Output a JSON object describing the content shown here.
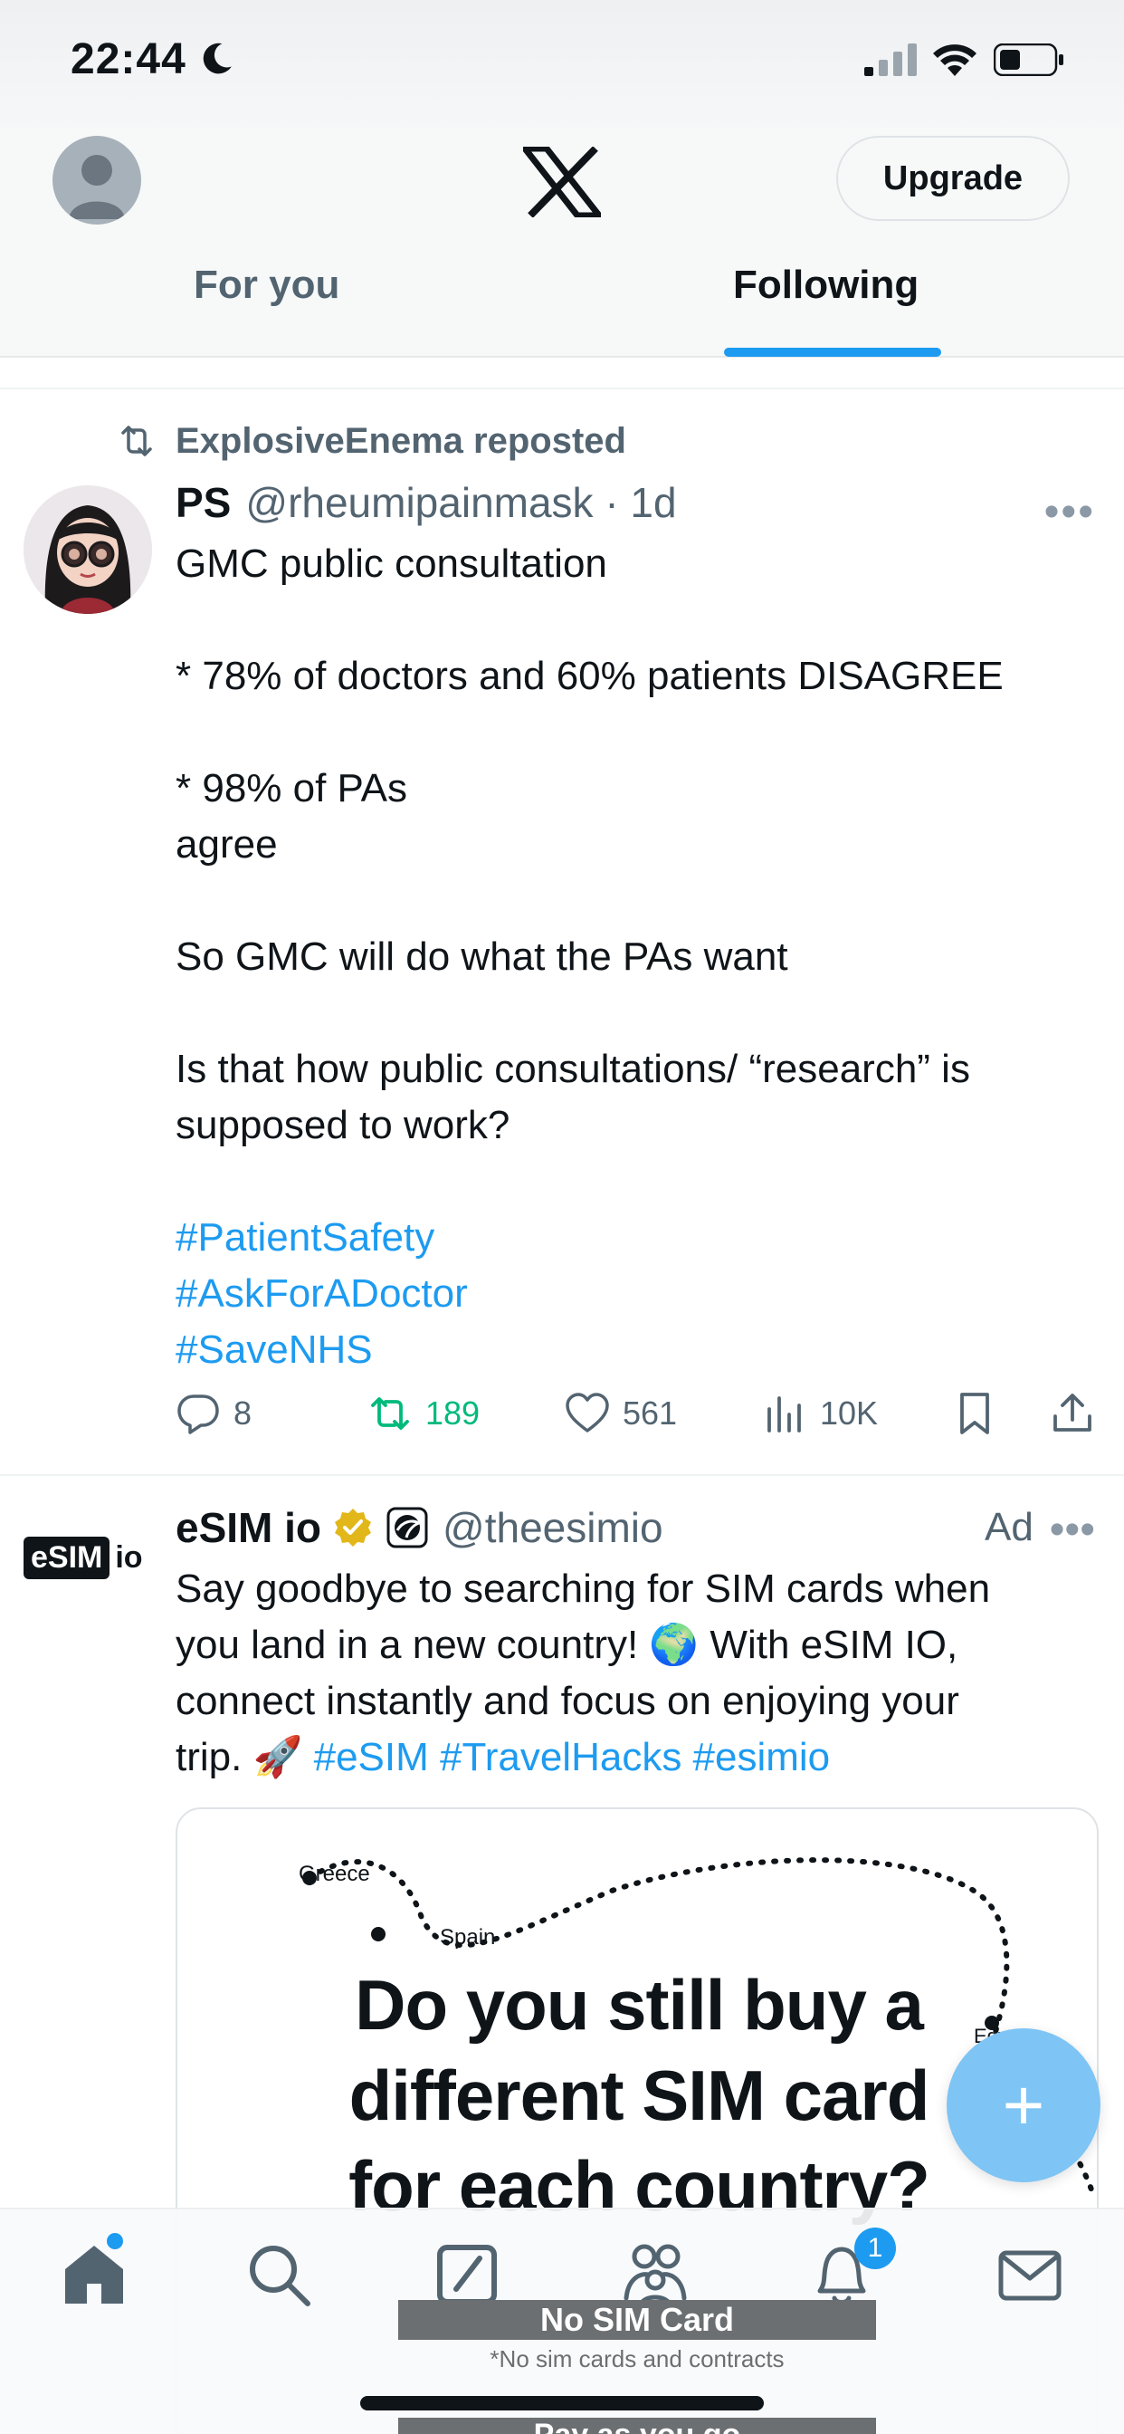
{
  "status_bar": {
    "time": "22:44"
  },
  "header": {
    "upgrade_label": "Upgrade",
    "tabs": [
      {
        "label": "For you",
        "active": false
      },
      {
        "label": "Following",
        "active": true
      }
    ]
  },
  "tweet1": {
    "repost_text": "ExplosiveEnema reposted",
    "name": "PS",
    "handle_time": "@rheumipainmask · 1d",
    "lines": [
      "GMC public consultation",
      "",
      "* 78% of doctors and 60% patients DISAGREE",
      "",
      "* 98% of PAs",
      "agree",
      "",
      "So GMC will do what the PAs want",
      "",
      "Is that how public consultations/ “research” is",
      "supposed to work?",
      ""
    ],
    "hashtags": [
      "#PatientSafety",
      "#AskForADoctor",
      "#SaveNHS"
    ],
    "stats": {
      "replies": "8",
      "reposts": "189",
      "likes": "561",
      "views": "10K"
    }
  },
  "tweet2": {
    "avatar_text_box": "eSIM",
    "avatar_text_suffix": "io",
    "name": "eSIM io",
    "handle": "@theesimio",
    "ad_label": "Ad",
    "line1": "Say goodbye to searching for SIM cards when",
    "line2": "you land in a new country! 🌍 With eSIM IO,",
    "line3": "connect instantly and focus on enjoying your",
    "line4_text": "trip. 🚀",
    "line4_tags": "#eSIM #TravelHacks #esimio",
    "media": {
      "cities": [
        "Greece",
        "Spain",
        "Egypt"
      ],
      "headline": [
        "Do you still buy a",
        "different SIM card",
        "for each country?"
      ],
      "no_sim_label": "No SIM Card",
      "no_sim_sub": "*No sim cards and contracts",
      "pay_label": "Pay as you go"
    }
  },
  "bottom_nav": {
    "items": [
      "home-icon",
      "search-icon",
      "grok-icon",
      "communities-icon",
      "notifications-icon",
      "messages-icon"
    ],
    "notification_count": "1"
  },
  "colors": {
    "accent": "#1d9bf0",
    "repost_green": "#00ba7c",
    "secondary_text": "#536471"
  }
}
